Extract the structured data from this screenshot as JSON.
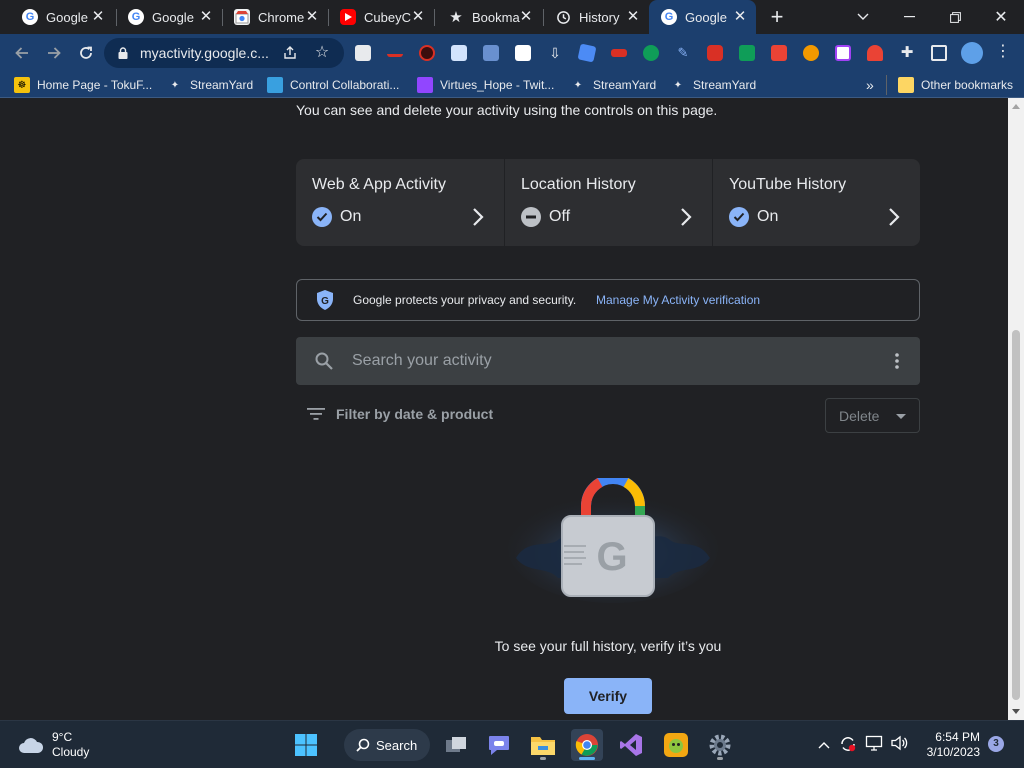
{
  "tabs": [
    {
      "title": "Google",
      "favicon": "google-g-icon",
      "active": false
    },
    {
      "title": "Google",
      "favicon": "google-g-icon",
      "active": false
    },
    {
      "title": "Chrome",
      "favicon": "chrome-web-store-icon",
      "active": false
    },
    {
      "title": "CubeyC",
      "favicon": "youtube-icon",
      "active": false
    },
    {
      "title": "Bookma",
      "favicon": "star-icon",
      "active": false
    },
    {
      "title": "History",
      "favicon": "history-icon",
      "active": false
    },
    {
      "title": "Google",
      "favicon": "google-g-icon",
      "active": true
    }
  ],
  "toolbar": {
    "url": "myactivity.google.c..."
  },
  "bookmarks": [
    {
      "label": "Home Page - TokuF...",
      "icon": "tokufun-icon"
    },
    {
      "label": "StreamYard",
      "icon": "streamyard-icon"
    },
    {
      "label": "Control Collaborati...",
      "icon": "monitor-icon"
    },
    {
      "label": "Virtues_Hope - Twit...",
      "icon": "twitch-icon"
    },
    {
      "label": "StreamYard",
      "icon": "streamyard-icon"
    },
    {
      "label": "StreamYard",
      "icon": "streamyard-icon"
    }
  ],
  "bookmarks_overflow": "»",
  "other_bookmarks": "Other bookmarks",
  "page": {
    "intro": "You can see and delete your activity using the controls on this page.",
    "controls": [
      {
        "title": "Web & App Activity",
        "status": "On"
      },
      {
        "title": "Location History",
        "status": "Off"
      },
      {
        "title": "YouTube History",
        "status": "On"
      }
    ],
    "privacy_text": "Google protects your privacy and security.",
    "privacy_link": "Manage My Activity verification",
    "search_placeholder": "Search your activity",
    "filter_label": "Filter by date & product",
    "delete_label": "Delete",
    "verify_prompt": "To see your full history, verify it’s you",
    "verify_button": "Verify"
  },
  "taskbar": {
    "temperature": "9°C",
    "condition": "Cloudy",
    "search_label": "Search",
    "time": "6:54 PM",
    "date": "3/10/2023",
    "notification_count": "3"
  },
  "colors": {
    "page_bg": "#202124",
    "chrome_frame": "#1c3f6e",
    "accent_blue": "#8ab4f8",
    "card_bg": "#2d2e31"
  }
}
